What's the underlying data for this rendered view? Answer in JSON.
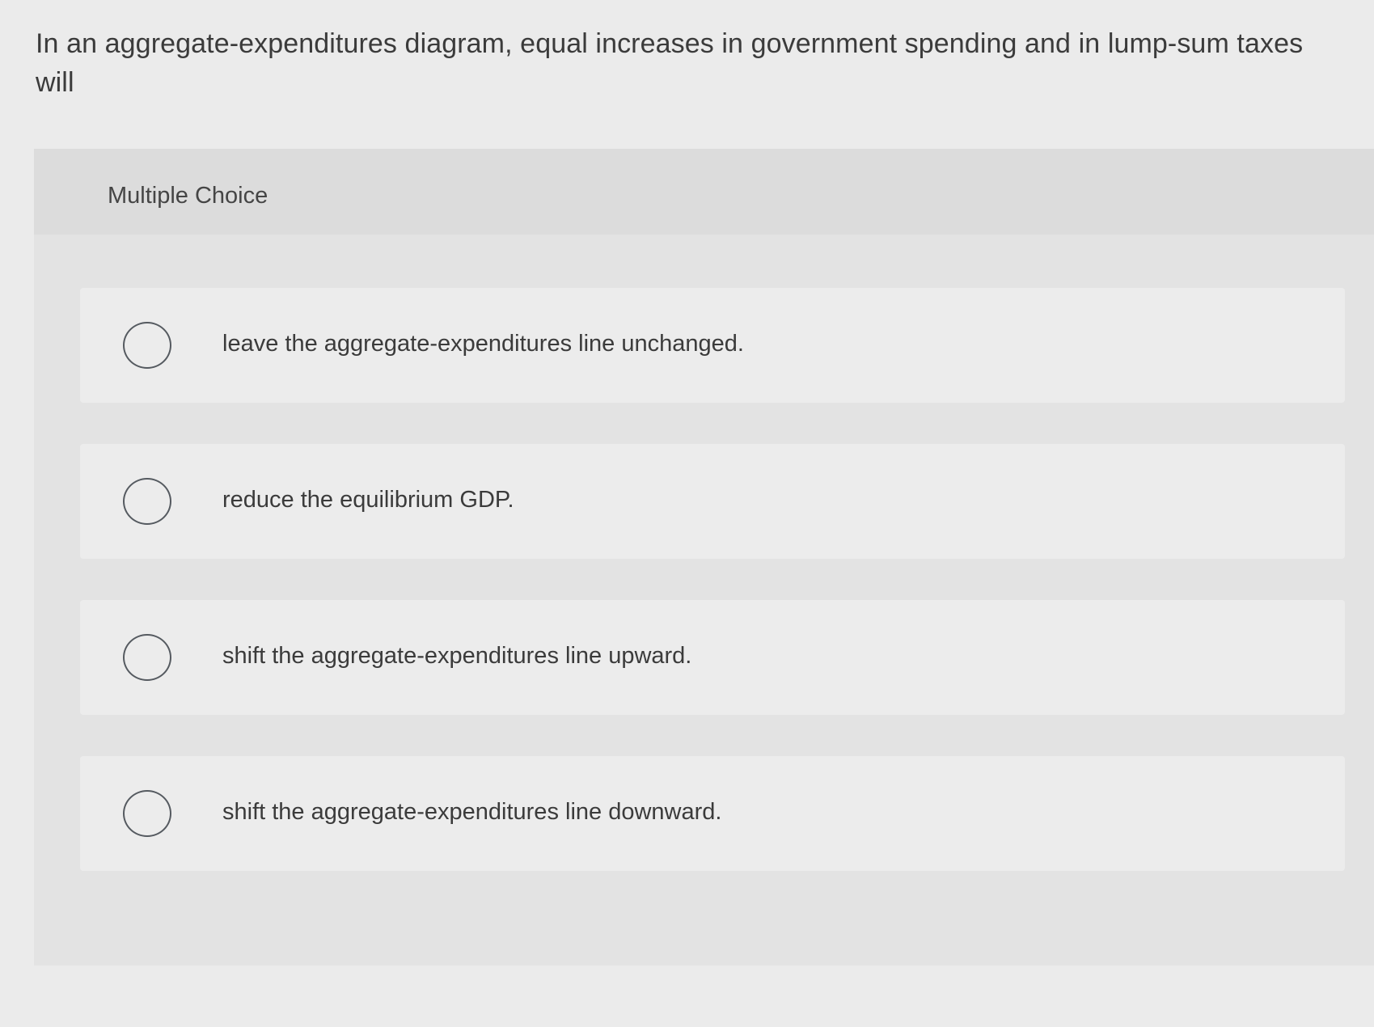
{
  "question": {
    "text": "In an aggregate-expenditures diagram, equal increases in government spending and in lump-sum taxes will"
  },
  "multiple_choice": {
    "header_label": "Multiple Choice",
    "options": [
      {
        "label": "leave the aggregate-expenditures line unchanged.",
        "selected": false
      },
      {
        "label": "reduce the equilibrium GDP.",
        "selected": false
      },
      {
        "label": "shift the aggregate-expenditures line upward.",
        "selected": false
      },
      {
        "label": "shift the aggregate-expenditures line downward.",
        "selected": false
      }
    ]
  },
  "colors": {
    "page_background": "#ebebeb",
    "panel_background": "#e3e3e3",
    "header_background": "#dcdcdc",
    "option_background": "#ececec",
    "radio_border": "#555a60",
    "text": "#3b3b3b"
  },
  "icons": {
    "radio": "radio-unchecked-icon"
  }
}
